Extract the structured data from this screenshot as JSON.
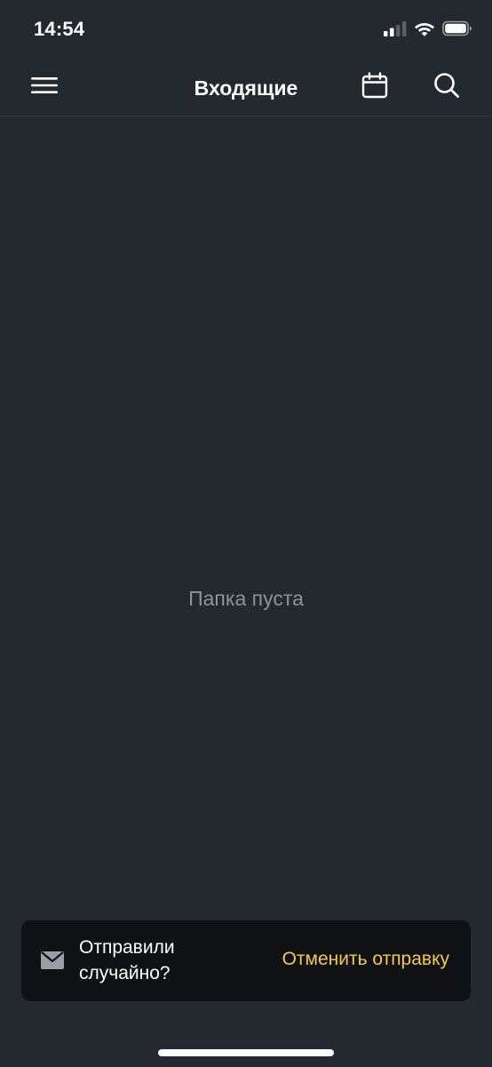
{
  "status_bar": {
    "time": "14:54",
    "icons": [
      "cellular-signal-icon",
      "wifi-icon",
      "battery-icon"
    ]
  },
  "nav": {
    "title": "Входящие",
    "icons": [
      "menu-icon",
      "calendar-icon",
      "search-icon"
    ]
  },
  "content": {
    "empty_text": "Папка пуста"
  },
  "snackbar": {
    "icon": "envelope-icon",
    "message_line1": "Отправили",
    "message_line2": "случайно?",
    "action_label": "Отменить отправку"
  },
  "colors": {
    "background": "#24282f",
    "snackbar_background": "#0f1114",
    "accent": "#f7c948",
    "muted_text": "#8e939b"
  }
}
